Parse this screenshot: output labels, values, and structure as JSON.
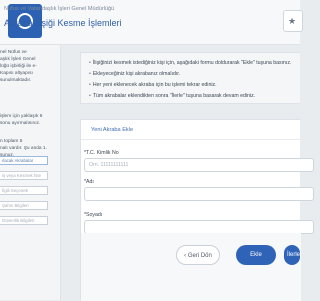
{
  "header": {
    "department": "Nüfus ve Vatandaşlık İşleri Genel Müdürlüğü",
    "title": "Akraba İlişiği Kesme İşlemleri",
    "star": "★"
  },
  "sidebar": {
    "text_1": "nel Nüfus ve\naşlık İşleri Genel\nlüğü işbirliği ile e-\nKapısı altyapısı\nsunulmaktadır.",
    "text_2": "işlem için yaklaşık 6\nsonu ayırmalısınız.",
    "text_3": "n toplam 5\nnalı vardır. Şu anda 1.\nsunuz.",
    "fields": [
      "ılacak Akrabalar",
      "iş veya Kesmek İste",
      "İlgili Seçenek",
      "Şahıs Bilgileri",
      "Güvenlik Bilgileri"
    ]
  },
  "info": {
    "items": [
      "İlişiğinizi kesmek istediğiniz kişi için, aşağıdaki formu doldurarak \"Ekle\" tuşuna basınız.",
      "Ekleyeceğiniz kişi akrabanız olmalıdır.",
      "Her yeni eklenecek akraba için bu işlemi tekrar ediniz.",
      "Tüm akrabalar eklendikten sonra \"İlerle\" tuşuna basarak devam ediniz."
    ]
  },
  "form": {
    "section_title": "Yeni Akraba Ekle",
    "tc_label": "*T.C. Kimlik No",
    "tc_placeholder": "Örn. 11111111111",
    "tc_value": "",
    "ad_label": "*Adı",
    "ad_value": "",
    "soyad_label": "*Soyadı",
    "soyad_value": ""
  },
  "buttons": {
    "back": "‹ Geri Dön",
    "add": "Ekle",
    "next": "İlerle"
  },
  "colors": {
    "primary": "#2f63b8",
    "header_title": "#2f5fa6",
    "section_title": "#3f6fb0"
  }
}
